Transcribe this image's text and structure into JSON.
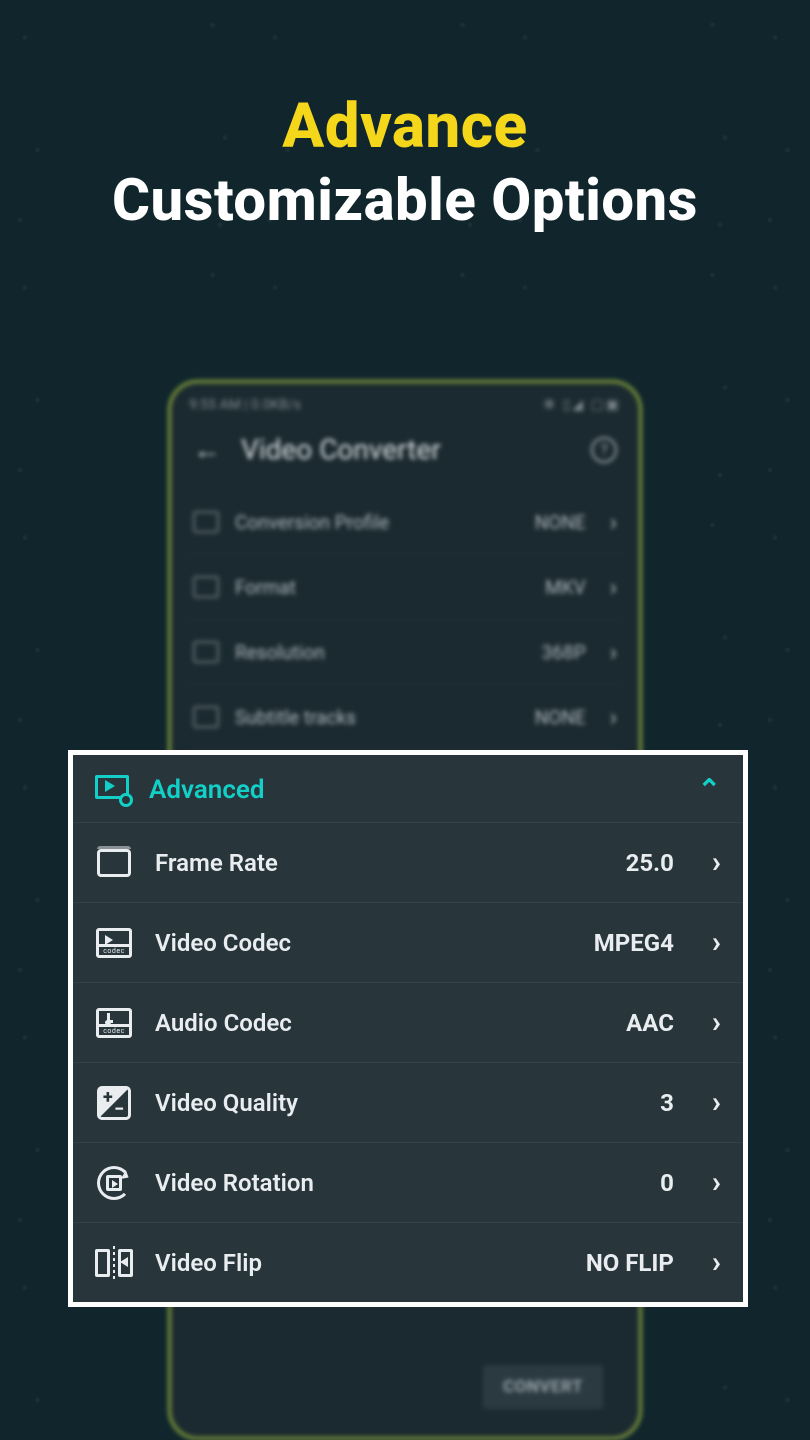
{
  "promo": {
    "line1": "Advance",
    "line2": "Customizable Options"
  },
  "phone": {
    "status_left": "9:55 AM | 0.0KB/s",
    "status_right": "✻ ▯◢ ▢▣",
    "app_title": "Video Converter",
    "rows": [
      {
        "label": "Conversion Profile",
        "value": "NONE"
      },
      {
        "label": "Format",
        "value": "MKV"
      },
      {
        "label": "Resolution",
        "value": "368P"
      },
      {
        "label": "Subtitle tracks",
        "value": "NONE"
      }
    ],
    "convert_label": "CONVERT"
  },
  "panel": {
    "header_label": "Advanced",
    "rows": [
      {
        "label": "Frame Rate",
        "value": "25.0",
        "icon": "framerate-icon"
      },
      {
        "label": "Video Codec",
        "value": "MPEG4",
        "icon": "video-codec-icon"
      },
      {
        "label": "Audio Codec",
        "value": "AAC",
        "icon": "audio-codec-icon"
      },
      {
        "label": "Video Quality",
        "value": "3",
        "icon": "video-quality-icon"
      },
      {
        "label": "Video Rotation",
        "value": "0",
        "icon": "video-rotation-icon"
      },
      {
        "label": "Video Flip",
        "value": "NO FLIP",
        "icon": "video-flip-icon"
      }
    ]
  }
}
